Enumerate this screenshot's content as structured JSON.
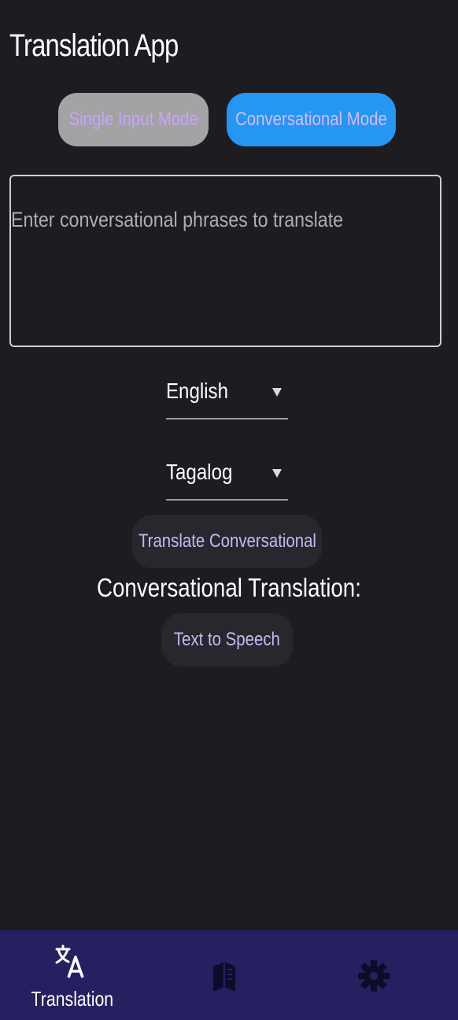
{
  "app": {
    "title": "Translation App"
  },
  "modes": {
    "single_label": "Single Input Mode",
    "conversational_label": "Conversational Mode",
    "active": "Conversational Mode"
  },
  "input": {
    "value": "",
    "placeholder": "Enter conversational phrases to translate"
  },
  "languages": {
    "source": "English",
    "target": "Tagalog"
  },
  "actions": {
    "translate_label": "Translate Conversational",
    "tts_label": "Text to Speech"
  },
  "result": {
    "heading": "Conversational Translation:",
    "text": ""
  },
  "bottom_nav": {
    "items": [
      {
        "label": "Translation",
        "icon": "translate-icon",
        "active": true
      },
      {
        "label": "",
        "icon": "book-icon",
        "active": false
      },
      {
        "label": "",
        "icon": "gear-icon",
        "active": false
      }
    ]
  },
  "colors": {
    "background": "#1d1c21",
    "accent_blue": "#2596f3",
    "inactive_mode": "#a3a3a3",
    "button_text": "#c9b6f5",
    "nav_background": "#252060",
    "nav_icon_inactive": "#0d0d2a"
  }
}
